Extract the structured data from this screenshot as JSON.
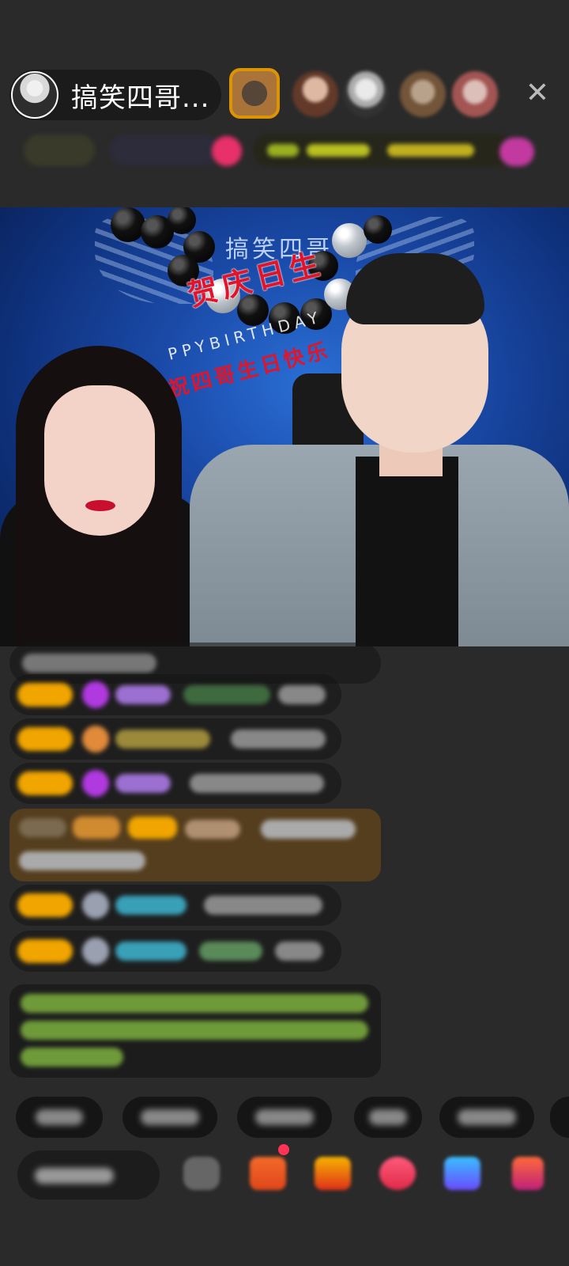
{
  "host": {
    "name": "搞笑四哥..."
  },
  "header": {
    "close_icon": "close-icon"
  },
  "stream": {
    "brand": "搞笑四哥",
    "banner_main": "贺庆日生",
    "banner_english": "PPYBIRTHDAY",
    "banner_red": "祝四哥生日快乐"
  },
  "colors": {
    "background": "#2a2a2a",
    "level_badge": "#f0a500",
    "accent_red": "#e0142a"
  }
}
